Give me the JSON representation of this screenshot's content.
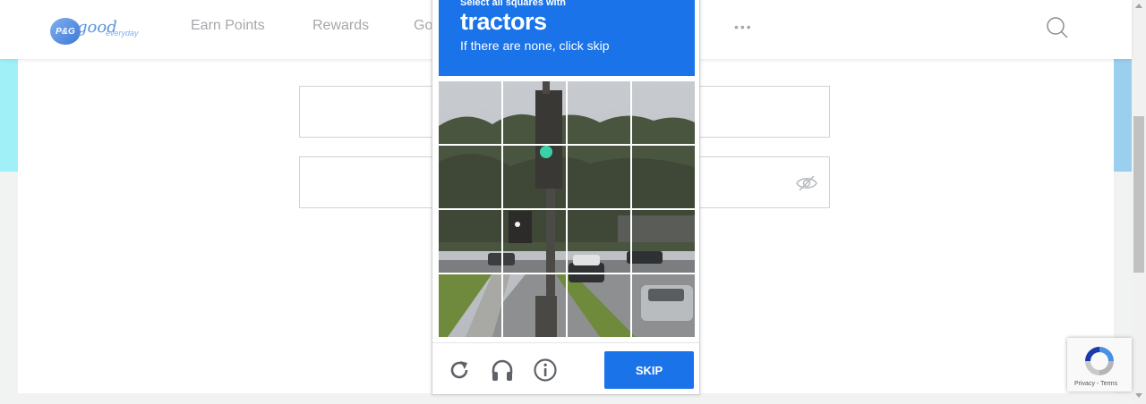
{
  "header": {
    "logo": {
      "brand": "P&G",
      "word": "good",
      "suffix": "everyday"
    },
    "nav": [
      {
        "label": "Earn Points"
      },
      {
        "label": "Rewards"
      },
      {
        "label": "Go"
      }
    ],
    "more": "•••"
  },
  "captcha": {
    "instruction": "Select all squares with",
    "object": "tractors",
    "subtext": "If there are none, click skip",
    "skip_label": "SKIP",
    "colors": {
      "accent": "#1a73e8"
    }
  },
  "recaptcha_badge": {
    "privacy": "Privacy",
    "separator": " - ",
    "terms": "Terms"
  },
  "colors": {
    "nav_text": "#a5a8ab",
    "cyan": "#9ff1f7",
    "page_bg": "#f1f3f3"
  }
}
